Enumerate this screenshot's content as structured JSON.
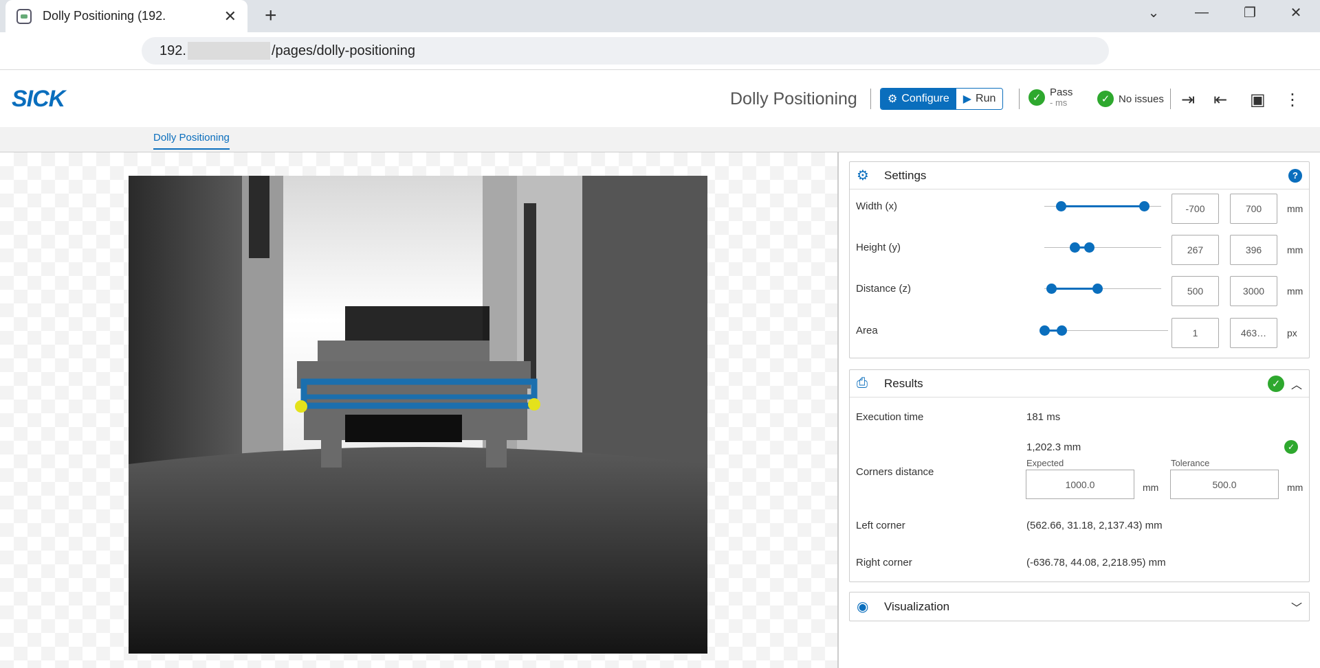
{
  "browser": {
    "tab_title": "Dolly Positioning (192.",
    "tab_close": "✕",
    "new_tab": "+",
    "url_prefix": "192.",
    "url_suffix": "/pages/dolly-positioning",
    "window_controls": [
      "chevron-down-icon",
      "minimize-icon",
      "restore-icon",
      "close-icon"
    ]
  },
  "header": {
    "logo": "SICK",
    "page_title": "Dolly Positioning",
    "configure_label": "Configure",
    "run_label": "Run",
    "pass_label": "Pass",
    "pass_time": "- ms",
    "issues_label": "No issues",
    "accent_color": "#0a6ebd",
    "ok_color": "#2ea82e"
  },
  "subnav": {
    "tab_label": "Dolly Positioning"
  },
  "settings": {
    "title": "Settings",
    "help": "?",
    "rows": [
      {
        "label": "Width (x)",
        "min": "-700",
        "max": "700",
        "unit": "mm",
        "range_min": 0.14,
        "range_max": 0.85
      },
      {
        "label": "Height (y)",
        "min": "267",
        "max": "396",
        "unit": "mm",
        "range_min": 0.26,
        "range_max": 0.38
      },
      {
        "label": "Distance (z)",
        "min": "500",
        "max": "3000",
        "unit": "mm",
        "range_min": 0.06,
        "range_max": 0.45
      },
      {
        "label": "Area",
        "min": "1",
        "max": "463…",
        "unit": "px",
        "range_min": 0.0,
        "range_max": 0.14
      }
    ]
  },
  "results": {
    "title": "Results",
    "execution_time_label": "Execution time",
    "execution_time_value": "181 ms",
    "corners_distance_label": "Corners distance",
    "corners_distance_value": "1,202.3 mm",
    "expected_label": "Expected",
    "expected_value": "1000.0",
    "expected_unit": "mm",
    "tolerance_label": "Tolerance",
    "tolerance_value": "500.0",
    "tolerance_unit": "mm",
    "left_corner_label": "Left corner",
    "left_corner_value": "(562.66, 31.18, 2,137.43) mm",
    "right_corner_label": "Right corner",
    "right_corner_value": "(-636.78, 44.08, 2,218.95) mm"
  },
  "visualization": {
    "title": "Visualization"
  }
}
